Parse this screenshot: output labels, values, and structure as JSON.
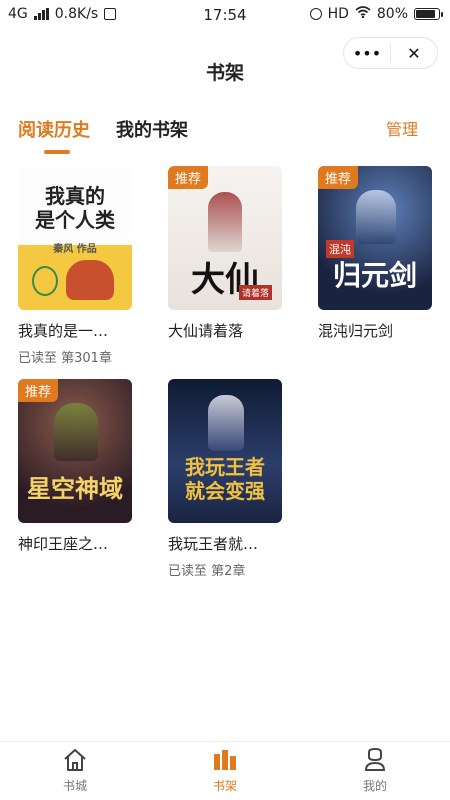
{
  "status_bar": {
    "network": "4G",
    "speed": "0.8K/s",
    "time": "17:54",
    "hd": "HD",
    "battery": "80%",
    "battery_level": 0.8
  },
  "header": {
    "title": "书架",
    "more_glyph": "•••",
    "close_glyph": "✕"
  },
  "tabs": [
    {
      "label": "阅读历史",
      "active": true
    },
    {
      "label": "我的书架",
      "active": false
    }
  ],
  "manage_label": "管理",
  "books": [
    {
      "title": "我真的是一…",
      "progress": "已读至  第301章",
      "badge": "",
      "cover_text": "我真的是个人类",
      "cover_sub": "秦风 作品",
      "cover_colors": [
        "#fdfdfd",
        "#f5c842"
      ]
    },
    {
      "title": "大仙请着落",
      "progress": "",
      "badge": "推荐",
      "cover_text": "大仙",
      "cover_sub": "请着落",
      "cover_colors": [
        "#f4f1ee",
        "#e8e3df"
      ]
    },
    {
      "title": "混沌归元剑",
      "progress": "",
      "badge": "推荐",
      "cover_text": "归元剑",
      "cover_sub": "混沌",
      "cover_colors": [
        "#1a2440",
        "#3d5a8c"
      ]
    },
    {
      "title": "神印王座之…",
      "progress": "",
      "badge": "推荐",
      "cover_text": "星空神域",
      "cover_sub": "神印王座之",
      "cover_colors": [
        "#2a1b24",
        "#6a3a3a"
      ]
    },
    {
      "title": "我玩王者就…",
      "progress": "已读至  第2章",
      "badge": "",
      "cover_text": "我玩王者就会变强",
      "cover_sub": "",
      "cover_colors": [
        "#0f1b33",
        "#2c3e6b"
      ]
    }
  ],
  "bottom_nav": [
    {
      "label": "书城",
      "icon": "home-icon",
      "active": false
    },
    {
      "label": "书架",
      "icon": "bookshelf-icon",
      "active": true
    },
    {
      "label": "我的",
      "icon": "profile-icon",
      "active": false
    }
  ],
  "colors": {
    "accent": "#e07a1f"
  }
}
